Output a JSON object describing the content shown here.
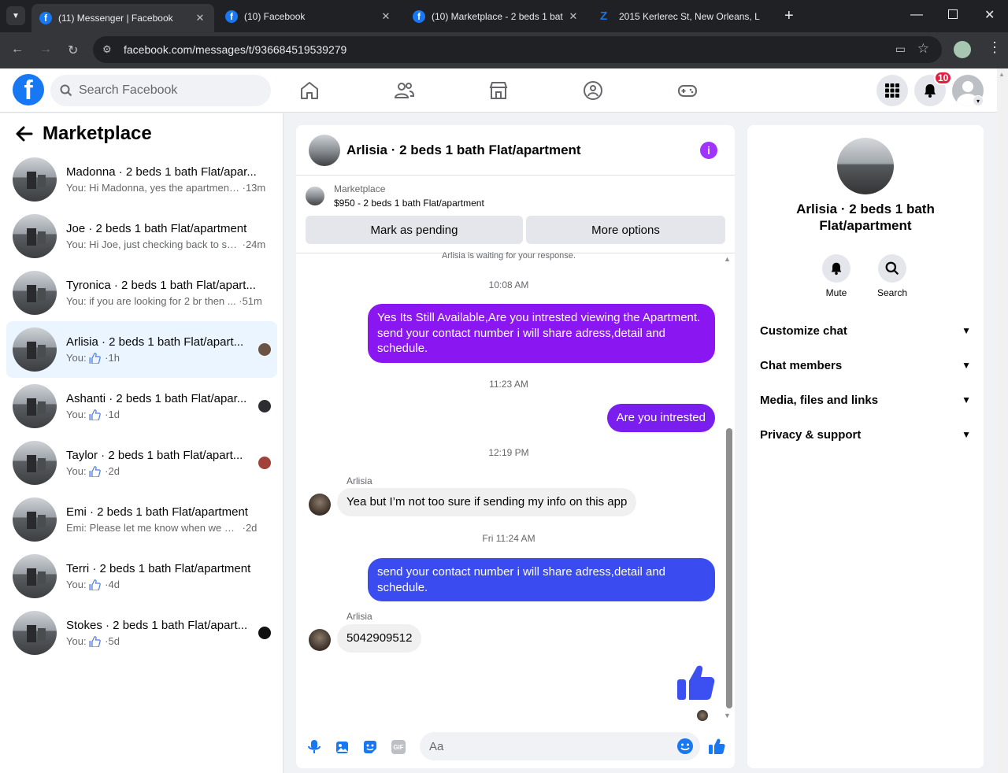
{
  "browser": {
    "tabs": [
      {
        "title": "(11) Messenger | Facebook",
        "active": true
      },
      {
        "title": "(10) Facebook",
        "active": false
      },
      {
        "title": "(10) Marketplace - 2 beds 1 bat",
        "active": false
      },
      {
        "title": "2015 Kerlerec St, New Orleans, L",
        "active": false
      }
    ],
    "url": "facebook.com/messages/t/936684519539279"
  },
  "fb": {
    "search_placeholder": "Search Facebook",
    "notif_count": "10",
    "brand_color": "#1877f2"
  },
  "sidebar": {
    "title": "Marketplace",
    "conversations": [
      {
        "name": "Madonna · 2 beds 1 bath Flat/apar...",
        "msg": "You: Hi Madonna, yes the apartment...",
        "time": "13m",
        "like": false
      },
      {
        "name": "Joe · 2 beds 1 bath Flat/apartment",
        "msg": "You: Hi Joe, just checking back to se...",
        "time": "24m",
        "like": false
      },
      {
        "name": "Tyronica · 2 beds 1 bath Flat/apart...",
        "msg": "You: if you are looking for 2 br then ...",
        "time": "51m",
        "like": false
      },
      {
        "name": "Arlisia · 2 beds 1 bath Flat/apart...",
        "msg": "You:",
        "time": "1h",
        "like": true
      },
      {
        "name": "Ashanti · 2 beds 1 bath Flat/apar...",
        "msg": "You:",
        "time": "1d",
        "like": true
      },
      {
        "name": "Taylor · 2 beds 1 bath Flat/apart...",
        "msg": "You:",
        "time": "2d",
        "like": true
      },
      {
        "name": "Emi · 2 beds 1 bath Flat/apartment",
        "msg": "Emi: Please let me know when we can...",
        "time": "2d",
        "like": false
      },
      {
        "name": "Terri · 2 beds 1 bath Flat/apartment",
        "msg": "You:",
        "time": "4d",
        "like": true
      },
      {
        "name": "Stokes · 2 beds 1 bath Flat/apart...",
        "msg": "You:",
        "time": "5d",
        "like": true
      }
    ]
  },
  "chat": {
    "title": "Arlisia · 2 beds 1 bath Flat/apartment",
    "marketplace_label": "Marketplace",
    "listing": "$950 - 2 beds 1 bath Flat/apartment",
    "mark_pending": "Mark as pending",
    "more_options": "More options",
    "waiting": "Arlisia is waiting for your response.",
    "messages": {
      "t1": "10:08 AM",
      "m1": "Yes Its Still Available,Are you intrested viewing the Apartment. send your contact number i will share adress,detail and schedule.",
      "t2": "11:23 AM",
      "m2": "Are you intrested",
      "t3": "12:19 PM",
      "s1": "Arlisia",
      "m3": "Yea but I’m not too sure if sending my info on this app",
      "t4": "Fri 11:24 AM",
      "m4": "send your contact number i will share adress,detail and schedule.",
      "s2": "Arlisia",
      "m5": "5042909512"
    },
    "composer_placeholder": "Aa",
    "colors": {
      "bubble_purple": "#8a16f2",
      "bubble_blue": "#3a4cf0",
      "like_blue": "#3c4ff0"
    }
  },
  "details": {
    "name": "Arlisia · 2 beds 1 bath Flat/apartment",
    "mute": "Mute",
    "search": "Search",
    "sections": [
      "Customize chat",
      "Chat members",
      "Media, files and links",
      "Privacy & support"
    ]
  }
}
